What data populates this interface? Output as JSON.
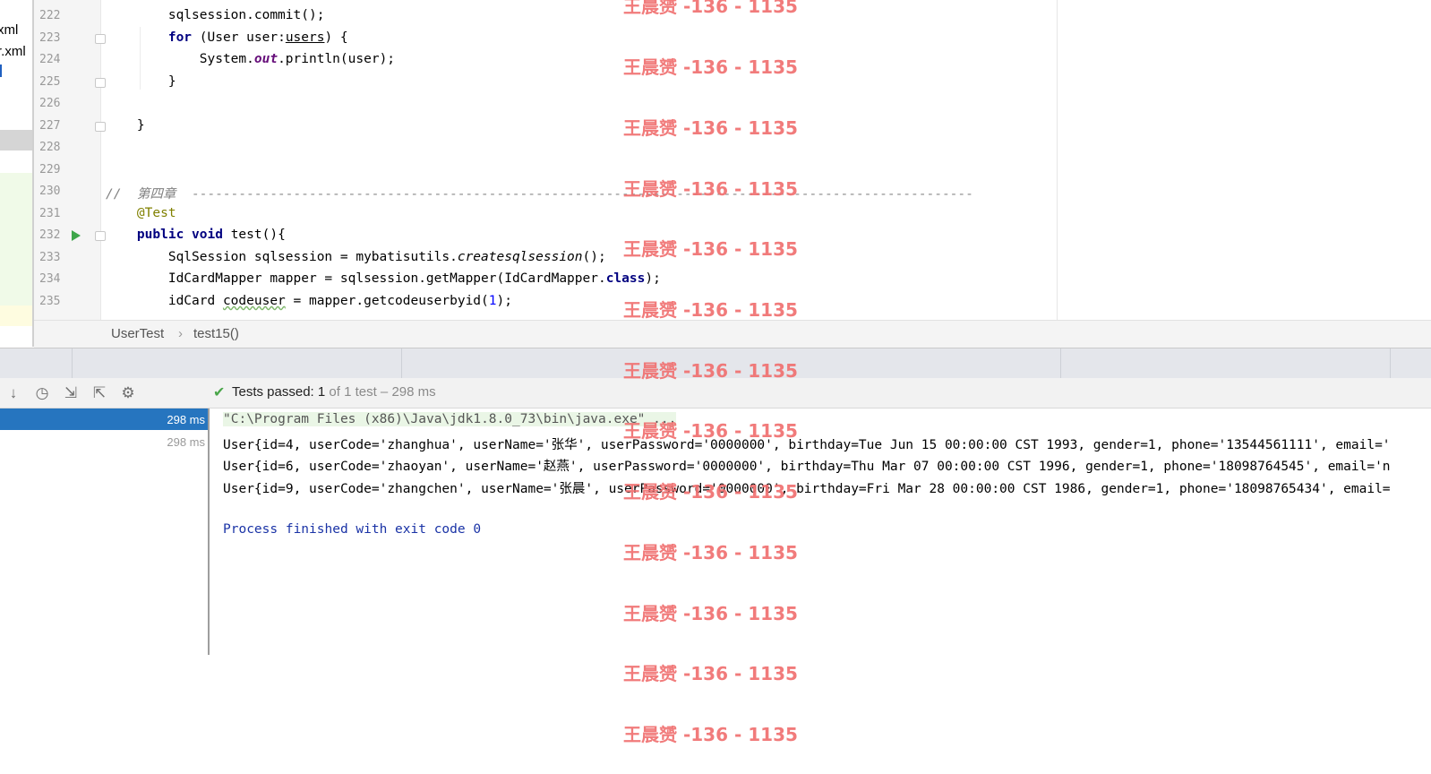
{
  "project_items": [
    "xml",
    "r.xml"
  ],
  "editor": {
    "lines": [
      {
        "n": "222",
        "html": "        sqlsession.commit();"
      },
      {
        "n": "223",
        "kind": "for"
      },
      {
        "n": "224",
        "kind": "println"
      },
      {
        "n": "225",
        "text": "        }"
      },
      {
        "n": "226",
        "text": ""
      },
      {
        "n": "227",
        "text": "    }"
      },
      {
        "n": "228",
        "text": ""
      },
      {
        "n": "229",
        "text": ""
      },
      {
        "n": "230",
        "kind": "comment"
      },
      {
        "n": "231",
        "kind": "annotation"
      },
      {
        "n": "232",
        "kind": "method"
      },
      {
        "n": "233",
        "kind": "session"
      },
      {
        "n": "234",
        "kind": "mapper"
      },
      {
        "n": "235",
        "kind": "codeuser"
      }
    ],
    "line222": "        sqlsession.commit();",
    "line223_kw": "for",
    "line223_a": " (User user:",
    "line223_b": "users",
    "line223_c": ") {",
    "line224_a": "            System.",
    "line224_b": "out",
    "line224_c": ".println(user);",
    "line225": "        }",
    "line227": "    }",
    "line230_a": "//  第四章  ",
    "line230_b": "----------------------------------------------------------------------------------------------------",
    "line231": "@Test",
    "line232_kw1": "public",
    "line232_kw2": "void",
    "line232_rest": " test(){",
    "line233_a": "        SqlSession sqlsession = mybatisutils.",
    "line233_b": "createsqlsession",
    "line233_c": "();",
    "line234_a": "        IdCardMapper mapper = sqlsession.getMapper(IdCardMapper.",
    "line234_b": "class",
    "line234_c": ");",
    "line235_a": "        idCard ",
    "line235_b": "codeuser",
    "line235_c": " = mapper.getcodeuserbyid(",
    "line235_d": "1",
    "line235_e": ");"
  },
  "breadcrumb": {
    "class_name": "UserTest",
    "method_name": "test15()"
  },
  "toolbar": {
    "status_main": "Tests passed: 1",
    "status_sub": " of 1 test – 298 ms"
  },
  "tree": [
    {
      "time": "298 ms",
      "selected": true
    },
    {
      "time": "298 ms",
      "selected": false
    }
  ],
  "console": {
    "cmd": "\"C:\\Program Files (x86)\\Java\\jdk1.8.0_73\\bin\\java.exe\" ...",
    "out1": "User{id=4, userCode='zhanghua', userName='张华', userPassword='0000000', birthday=Tue Jun 15 00:00:00 CST 1993, gender=1, phone='13544561111', email='",
    "out2": "User{id=6, userCode='zhaoyan', userName='赵燕', userPassword='0000000', birthday=Thu Mar 07 00:00:00 CST 1996, gender=1, phone='18098764545', email='n",
    "out3": "User{id=9, userCode='zhangchen', userName='张晨', userPassword='0000000', birthday=Fri Mar 28 00:00:00 CST 1986, gender=1, phone='18098765434', email=",
    "exit": "Process finished with exit code 0"
  },
  "watermark": "王晨赟 -136 - 1135",
  "colors": {
    "keyword": "#000080",
    "annotation": "#808000",
    "number": "#0000ff",
    "selection": "#2675bf",
    "pass": "#4aa64a",
    "watermark": "#f07070"
  }
}
